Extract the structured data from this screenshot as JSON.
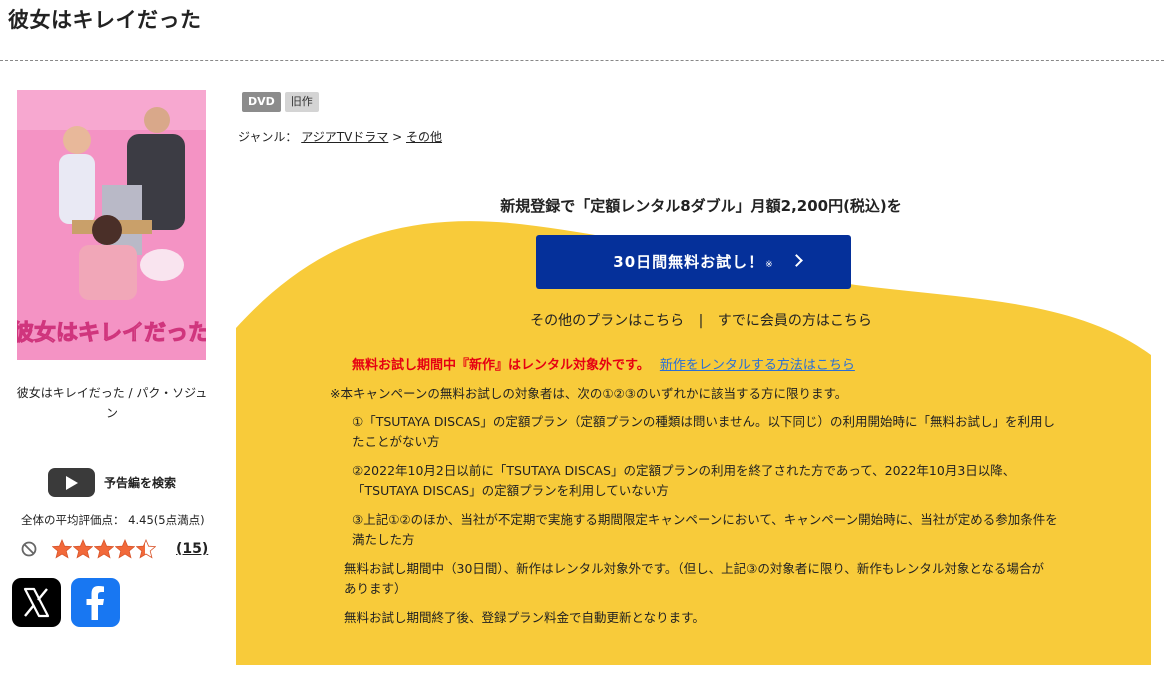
{
  "title": "彼女はキレイだった",
  "product": {
    "cover_title": "彼女はキレイだった",
    "caption": "彼女はキレイだった / パク・ソジュン",
    "trailer_label": "予告編を検索",
    "rating_text": "全体の平均評価点： 4.45(5点満点)",
    "rating_value": 4.45,
    "review_count": "(15)"
  },
  "badges": [
    "DVD",
    "旧作"
  ],
  "genre": {
    "label": "ジャンル：",
    "items": [
      "アジアTVドラマ",
      "その他"
    ],
    "separator": ">"
  },
  "promo": {
    "headline": "新規登録で「定額レンタル8ダブル」月額2,200円(税込)を",
    "button_label": "30日間無料お試し！",
    "button_mark": "※",
    "other_plans": "その他のプランはこちら",
    "separator": "|",
    "member_link": "すでに会員の方はこちら",
    "warning": "無料お試し期間中『新作』はレンタル対象外です。",
    "warning_link": "新作をレンタルする方法はこちら",
    "notes": [
      "※本キャンペーンの無料お試しの対象者は、次の①②③のいずれかに該当する方に限ります。",
      "①「TSUTAYA DISCAS」の定額プラン（定額プランの種類は問いません。以下同じ）の利用開始時に「無料お試し」を利用したことがない方",
      "②2022年10月2日以前に「TSUTAYA DISCAS」の定額プランの利用を終了された方であって、2022年10月3日以降、「TSUTAYA DISCAS」の定額プランを利用していない方",
      "③上記①②のほか、当社が不定期で実施する期間限定キャンペーンにおいて、キャンペーン開始時に、当社が定める参加条件を満たした方",
      "無料お試し期間中（30日間）、新作はレンタル対象外です。（但し、上記③の対象者に限り、新作もレンタル対象となる場合があります）",
      "無料お試し期間終了後、登録プラン料金で自動更新となります。"
    ]
  },
  "colors": {
    "accent_yellow": "#f8cb3a",
    "button_blue": "#05309a",
    "warning_red": "#e60012",
    "link_blue": "#2a6fd6",
    "star_orange": "#f2693a"
  },
  "icons": {
    "trailer": "play-icon",
    "not_interested": "prohibited-icon",
    "share_x": "x-logo-icon",
    "share_facebook": "facebook-logo-icon"
  }
}
